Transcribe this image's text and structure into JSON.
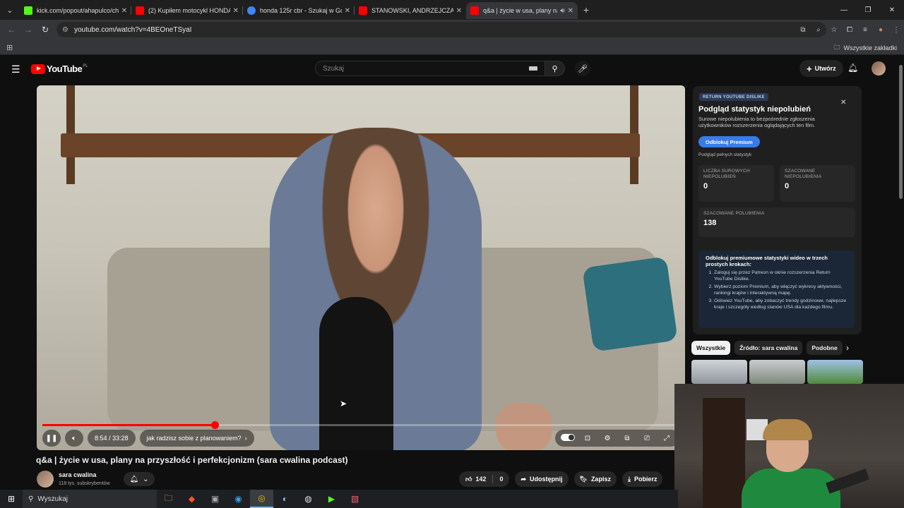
{
  "browser": {
    "tabs": [
      {
        "title": "kick.com/popout/ahapulco/cha",
        "fav_color": "#53fc18"
      },
      {
        "title": "(2) Kupiłem motocykl HONDA",
        "fav_color": "#ff0000"
      },
      {
        "title": "honda 125r cbr - Szukaj w Goo",
        "fav_color": "#4285f4"
      },
      {
        "title": "STANOWSKI, ANDRZEJCZAK, D",
        "fav_color": "#ff0000"
      },
      {
        "title": "q&a | życie w usa, plany na",
        "fav_color": "#ff0000",
        "active": true
      }
    ],
    "url": "youtube.com/watch?v=4BEOneTSyaI",
    "all_bookmarks": "Wszystkie zakładki"
  },
  "youtube": {
    "logo_text": "YouTube",
    "country": "PL",
    "search_placeholder": "Szukaj",
    "create_label": "Utwórz"
  },
  "player": {
    "time": "8:54 / 33:28",
    "chapter": "jak radzisz sobie z planowaniem?",
    "progress_fraction": 0.27,
    "buffered_fraction": 0.28
  },
  "video": {
    "title": "q&a | życie w usa, plany na przyszłość i perfekcjonizm (sara cwalina podcast)",
    "channel": "sara cwalina",
    "subscribers": "118 tys. subskrybentów",
    "likes": "142",
    "dislikes": "0",
    "share": "Udostępnij",
    "save": "Zapisz",
    "download": "Pobierz"
  },
  "ryd": {
    "badge": "RETURN YOUTUBE DISLIKE",
    "title": "Podgląd statystyk niepolubień",
    "description": "Surowe niepolubienia to bezpośrednie zgłoszenia użytkowników rozszerzenia oglądających ten film.",
    "unlock_button": "Odblokuj Premium",
    "full_stats_link": "Podgląd pełnych statystyk",
    "stats": [
      {
        "label": "LICZBA SUROWYCH NIEPOLUBIEŃ",
        "value": "0"
      },
      {
        "label": "SZACOWANE NIEPOLUBIENIA",
        "value": "0"
      },
      {
        "label": "SZACOWANE POLUBIENIA",
        "value": "138"
      }
    ],
    "info_heading": "Odblokuj premiumowe statystyki wideo w trzech prostych krokach:",
    "steps": [
      "Zaloguj się przez Patreon w oknie rozszerzenia Return YouTube Dislike.",
      "Wybierz poziom Premium, aby włączyć wykresy aktywności, rankingi krajów i interaktywną mapę.",
      "Odśwież YouTube, aby zobaczyć trendy godzinowe, najlepsze kraje i szczegóły według stanów USA dla każdego filmu."
    ]
  },
  "chips": [
    "Wszystkie",
    "Źródło: sara cwalina",
    "Podobne"
  ],
  "taskbar": {
    "search_label": "Wyszukaj"
  },
  "colors": {
    "accent_red": "#ff0000",
    "ryd_blue": "#3a7bea",
    "bg": "#0f0f0f"
  }
}
